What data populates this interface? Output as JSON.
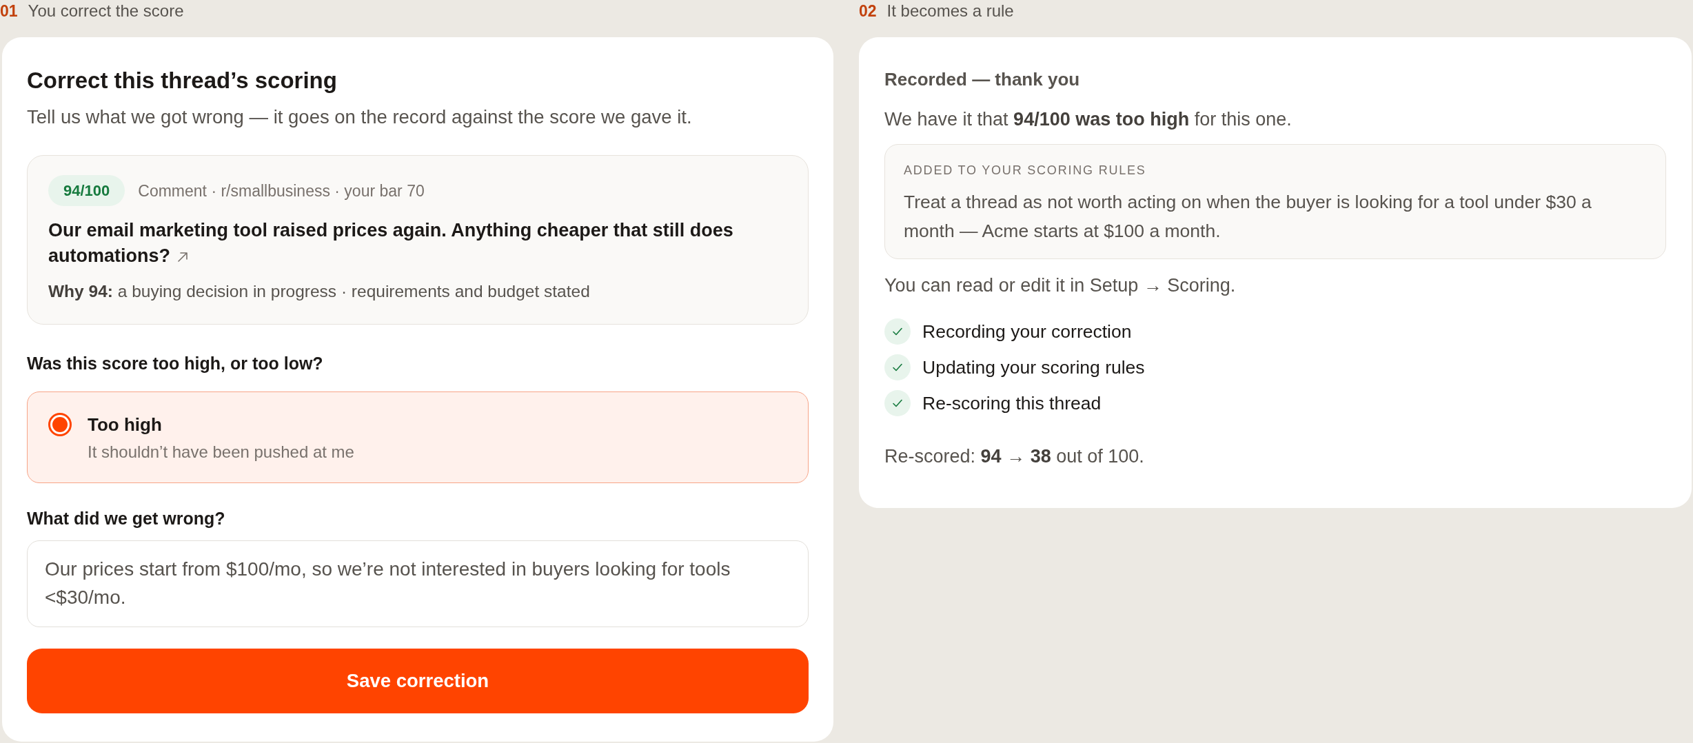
{
  "columns": [
    {
      "kind": "correction_form",
      "step": {
        "number": "01",
        "label": "You correct the score"
      },
      "card": {
        "title": "Correct this thread’s scoring",
        "subtitle": "Tell us what we got wrong — it goes on the record against the score we gave it.",
        "thread": {
          "score": "94/100",
          "meta": "Comment · r/smallbusiness · your bar 70",
          "title": "Our email marketing tool raised prices again. Anything cheaper that still does automations?",
          "reason": "**Why 94:** a buying decision in progress · requirements and budget stated"
        },
        "question": "Was this score too high, or too low?",
        "options": [
          {
            "label": "Too high",
            "description": "It shouldn’t have been pushed at me",
            "selected": true
          }
        ],
        "feedback": {
          "label": "What did we get wrong?",
          "value": "Our prices start from $100/mo, so we’re not interested in buyers looking for tools <$30/mo."
        },
        "submit_button": "Save correction"
      }
    },
    {
      "kind": "confirmation",
      "step": {
        "number": "02",
        "label": "It becomes a rule"
      },
      "card": {
        "title": "Recorded — thank you",
        "summary": "We have it that **94/100 was too high** for this one.",
        "rule": {
          "heading": "ADDED TO YOUR SCORING RULES",
          "text": "Treat a thread as not worth acting on when the buyer is looking for a tool under $30 a month — Acme starts at $100 a month."
        },
        "note": "You can read or edit it in Setup → Scoring.",
        "progress": [
          {
            "label": "Recording your correction",
            "checked": true
          },
          {
            "label": "Updating your scoring rules",
            "checked": true
          },
          {
            "label": "Re-scoring this thread",
            "checked": true
          }
        ],
        "result": "Re-scored: **94** → **38** out of 100."
      }
    }
  ]
}
